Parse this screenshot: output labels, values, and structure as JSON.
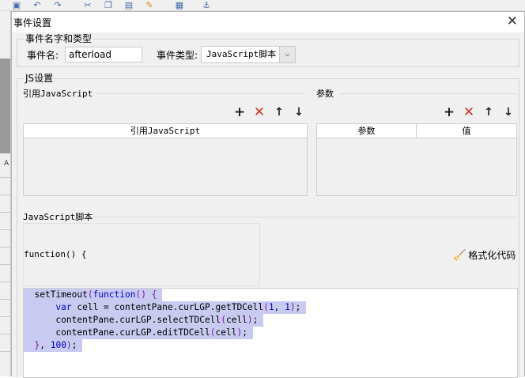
{
  "window": {
    "title": "事件设置",
    "close_glyph": "✕"
  },
  "toolbar_icons": [
    "save-icon",
    "undo-icon",
    "redo-icon",
    "cut-icon",
    "copy-icon",
    "paste-icon",
    "brush-icon",
    "preview-icon",
    "plugin-icon"
  ],
  "background": {
    "cell_label": "A"
  },
  "event_group": {
    "legend": "事件名字和类型",
    "name_label": "事件名:",
    "name_value": "afterload",
    "type_label": "事件类型:",
    "type_value": "JavaScript脚本"
  },
  "js_group": {
    "legend": "JS设置",
    "ref_section": {
      "title": "引用JavaScript",
      "column": "引用JavaScript"
    },
    "param_section": {
      "title": "参数",
      "columns": [
        "参数",
        "值"
      ]
    },
    "buttons": {
      "add": "+",
      "delete": "✕",
      "up": "↑",
      "down": "↓"
    },
    "script_section": {
      "title": "JavaScript脚本",
      "function_header": "function() {",
      "format_label": "格式化代码"
    },
    "code_lines": [
      "  setTimeout(function() {",
      "    var cell = contentPane.curLGP.getTDCell(1, 1);",
      "    contentPane.curLGP.selectTDCell(cell);",
      "    contentPane.curLGP.editTDCell(cell);",
      "  }, 100);"
    ]
  }
}
